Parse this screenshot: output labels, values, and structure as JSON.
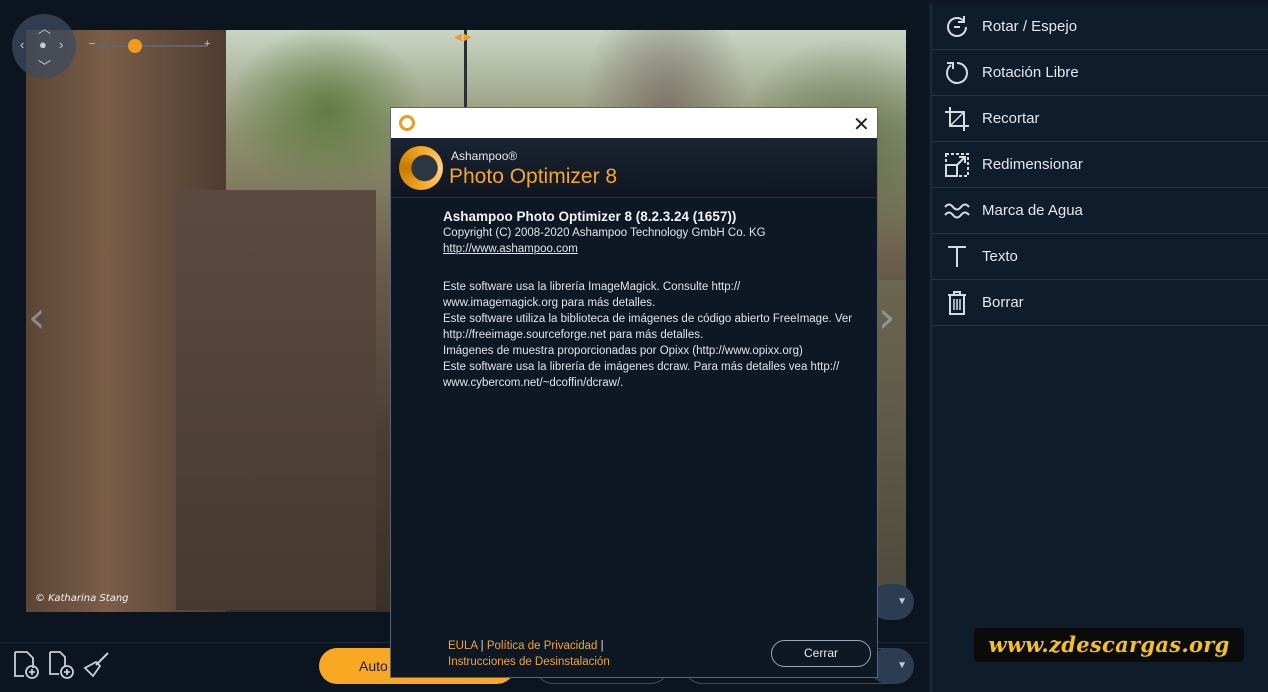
{
  "photo": {
    "credit": "© Katharina Stang"
  },
  "sidebar": {
    "items": [
      {
        "label": "Rotar / Espejo",
        "icon": "rotate-mirror-icon"
      },
      {
        "label": "Rotación Libre",
        "icon": "free-rotation-icon"
      },
      {
        "label": "Recortar",
        "icon": "crop-icon"
      },
      {
        "label": "Redimensionar",
        "icon": "resize-icon"
      },
      {
        "label": "Marca de Agua",
        "icon": "watermark-icon"
      },
      {
        "label": "Texto",
        "icon": "text-icon"
      },
      {
        "label": "Borrar",
        "icon": "trash-icon"
      }
    ]
  },
  "bottombar": {
    "auto_label": "Auto"
  },
  "watermark_text": "www.zdescargas.org",
  "dialog": {
    "brand": "Ashampoo®",
    "product": "Photo Optimizer 8",
    "version": "Ashampoo Photo Optimizer 8 (8.2.3.24 (1657))",
    "copyright": "Copyright (C) 2008-2020 Ashampoo Technology GmbH Co. KG",
    "url": "http://www.ashampoo.com",
    "credits": [
      "Este software usa la librería ImageMagick. Consulte http://",
      "www.imagemagick.org para más detalles.",
      "Este software utiliza la biblioteca de imágenes de código abierto FreeImage. Ver",
      "http://freeimage.sourceforge.net para más detalles.",
      "Imágenes de muestra proporcionadas por Opixx (http://www.opixx.org)",
      "Este software usa la librería de imágenes dcraw. Para más detalles vea http://",
      "www.cybercom.net/~dcoffin/dcraw/."
    ],
    "link_eula": "EULA",
    "link_privacy": "Política de Privacidad",
    "link_uninstall": "Instrucciones de Desinstalación",
    "separator": "|",
    "close_button": "Cerrar"
  },
  "colors": {
    "accent": "#f5a623",
    "sidebar_bg": "#0f1c2c",
    "dialog_bg": "#0e1724"
  }
}
